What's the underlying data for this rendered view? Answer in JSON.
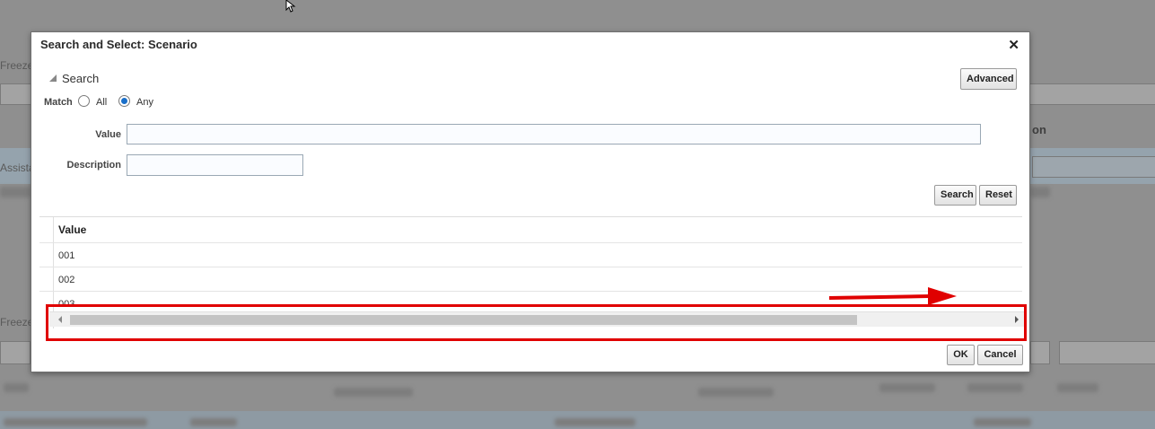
{
  "background": {
    "freeze_label_1": "Freeze",
    "freeze_label_2": "Freeze",
    "assist_label": "Assista",
    "column_fragment": "on"
  },
  "dialog": {
    "title": "Search and Select: Scenario",
    "close_glyph": "✕",
    "search_section_label": "Search",
    "advanced_button": "Advanced",
    "match_label": "Match",
    "match_options": [
      {
        "label": "All",
        "selected": false
      },
      {
        "label": "Any",
        "selected": true
      }
    ],
    "value_label": "Value",
    "value_input": "",
    "description_label": "Description",
    "description_input": "",
    "search_button": "Search",
    "reset_button": "Reset",
    "table": {
      "header": "Value",
      "rows": [
        "001",
        "002",
        "003"
      ]
    },
    "ok_button": "OK",
    "cancel_button": "Cancel"
  },
  "colors": {
    "annotation": "#e00000",
    "radio_selected": "#1a6fc9"
  },
  "icons": [
    "cursor-arrow-icon",
    "close-icon",
    "collapse-triangle-icon",
    "scroll-left-icon",
    "scroll-right-icon",
    "annotation-arrow-icon"
  ]
}
